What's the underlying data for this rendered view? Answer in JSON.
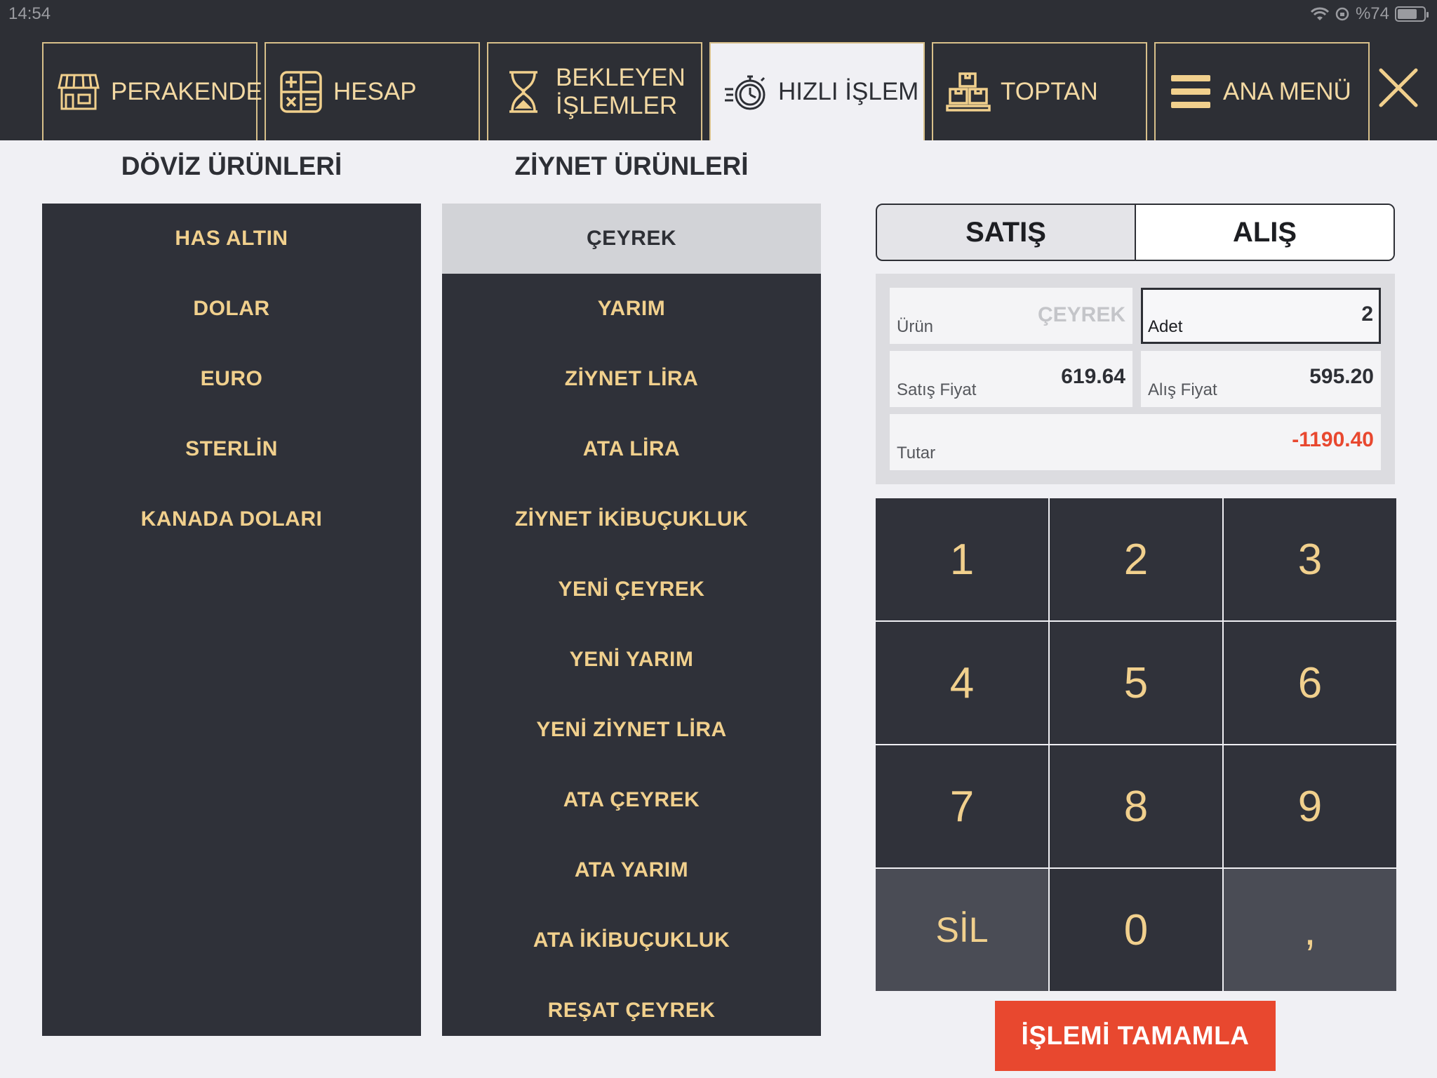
{
  "status": {
    "time": "14:54",
    "battery_text": "%74",
    "battery_level": 0.74
  },
  "tabs": [
    {
      "label_lines": [
        "PERAKENDE"
      ],
      "icon": "store-icon"
    },
    {
      "label_lines": [
        "HESAP"
      ],
      "icon": "calculator-icon"
    },
    {
      "label_lines": [
        "BEKLEYEN",
        "İŞLEMLER"
      ],
      "icon": "hourglass-icon"
    },
    {
      "label_lines": [
        "HIZLI İŞLEM"
      ],
      "icon": "stopwatch-icon",
      "active": true
    },
    {
      "label_lines": [
        "TOPTAN"
      ],
      "icon": "boxes-icon"
    },
    {
      "label_lines": [
        "ANA MENÜ"
      ],
      "icon": "menu-icon"
    }
  ],
  "doviz": {
    "title": "DÖVİZ ÜRÜNLERİ",
    "items": [
      "HAS ALTIN",
      "DOLAR",
      "EURO",
      "STERLİN",
      "KANADA DOLARI"
    ]
  },
  "ziynet": {
    "title": "ZİYNET ÜRÜNLERİ",
    "selected_index": 0,
    "items": [
      "ÇEYREK",
      "YARIM",
      "ZİYNET LİRA",
      "ATA LİRA",
      "ZİYNET İKİBUÇUKLUK",
      "YENİ ÇEYREK",
      "YENİ YARIM",
      "YENİ ZİYNET LİRA",
      "ATA ÇEYREK",
      "ATA YARIM",
      "ATA İKİBUÇUKLUK",
      "REŞAT ÇEYREK"
    ]
  },
  "segment": {
    "sell": "SATIŞ",
    "buy": "ALIŞ",
    "active": "buy"
  },
  "info": {
    "urun_label": "Ürün",
    "urun_value": "ÇEYREK",
    "adet_label": "Adet",
    "adet_value": "2",
    "satis_label": "Satış Fiyat",
    "satis_value": "619.64",
    "alis_label": "Alış Fiyat",
    "alis_value": "595.20",
    "tutar_label": "Tutar",
    "tutar_value": "-1190.40"
  },
  "keypad": [
    "1",
    "2",
    "3",
    "4",
    "5",
    "6",
    "7",
    "8",
    "9",
    "SİL",
    "0",
    ","
  ],
  "complete_button": "İŞLEMİ TAMAMLA",
  "colors": {
    "header_bg": "#2d2f35",
    "gold": "#f1d08d",
    "accent_red": "#e8482f",
    "negative": "#e8482f"
  }
}
